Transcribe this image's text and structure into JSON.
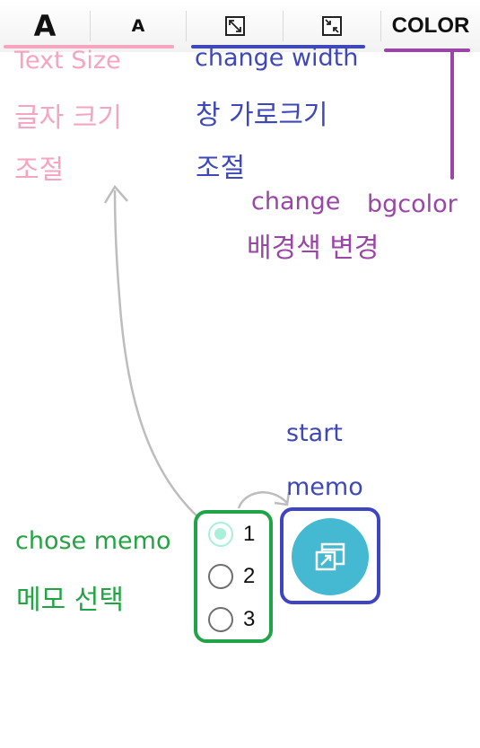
{
  "toolbar": {
    "text_large_label": "A",
    "text_small_label": "A",
    "widen_icon": "expand-diagonal-icon",
    "narrow_icon": "collapse-diagonal-icon",
    "color_label": "COLOR"
  },
  "annotations": {
    "text_size_en": "Text Size",
    "text_size_ko_1": "글자 크기",
    "text_size_ko_2": "조절",
    "width_en": "change width",
    "width_ko_1": "창 가로크기",
    "width_ko_2": "조절",
    "bg_en_1": "change",
    "bg_en_2": "bgcolor",
    "bg_ko": "배경색 변경",
    "memo_en": "chose memo",
    "memo_ko": "메모 선택",
    "start_en_1": "start",
    "start_en_2": "memo"
  },
  "memo_selector": {
    "options": [
      "1",
      "2",
      "3"
    ],
    "selected": "1"
  },
  "start_button_icon": "open-window-icon",
  "colors": {
    "pink": "#f6a5be",
    "blue": "#3e48b8",
    "purple": "#9a46a6",
    "green": "#23a444",
    "fab": "#45b9d1",
    "radio_checked": "#a9f0db"
  }
}
